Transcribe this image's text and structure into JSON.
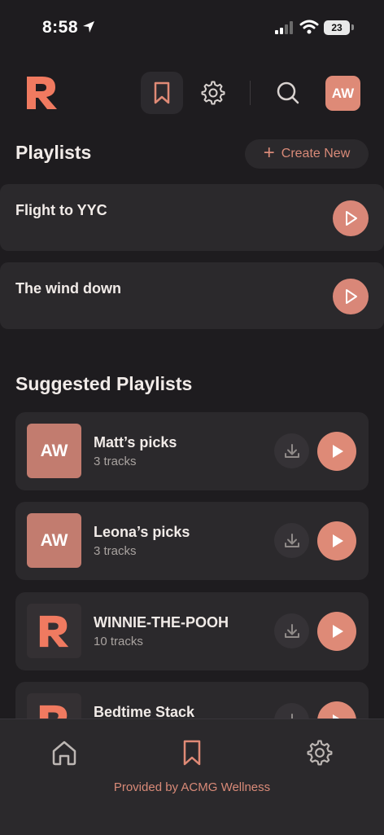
{
  "status_bar": {
    "time": "8:58",
    "battery": "23"
  },
  "header": {
    "avatar_initials": "AW"
  },
  "playlists": {
    "title": "Playlists",
    "create_label": "Create New",
    "items": [
      {
        "name": "Flight to YYC"
      },
      {
        "name": "The wind down"
      }
    ]
  },
  "suggested": {
    "title": "Suggested Playlists",
    "items": [
      {
        "name": "Matt’s picks",
        "tracks": "3 tracks",
        "thumb": "AW"
      },
      {
        "name": "Leona’s picks",
        "tracks": "3 tracks",
        "thumb": "AW"
      },
      {
        "name": "WINNIE-THE-POOH",
        "tracks": "10 tracks",
        "thumb": "logo"
      },
      {
        "name": "Bedtime Stack",
        "tracks": "",
        "thumb": "logo"
      }
    ]
  },
  "footer": {
    "provided_by": "Provided by ACMG Wellness"
  },
  "colors": {
    "accent": "#de8a77",
    "background": "#1e1c1f",
    "card": "#2b292c"
  },
  "icons": [
    "location-arrow-icon",
    "signal-icon",
    "wifi-icon",
    "battery-icon",
    "logo-r-icon",
    "bookmark-icon",
    "gear-icon",
    "search-icon",
    "plus-icon",
    "play-icon",
    "download-icon",
    "home-icon"
  ]
}
